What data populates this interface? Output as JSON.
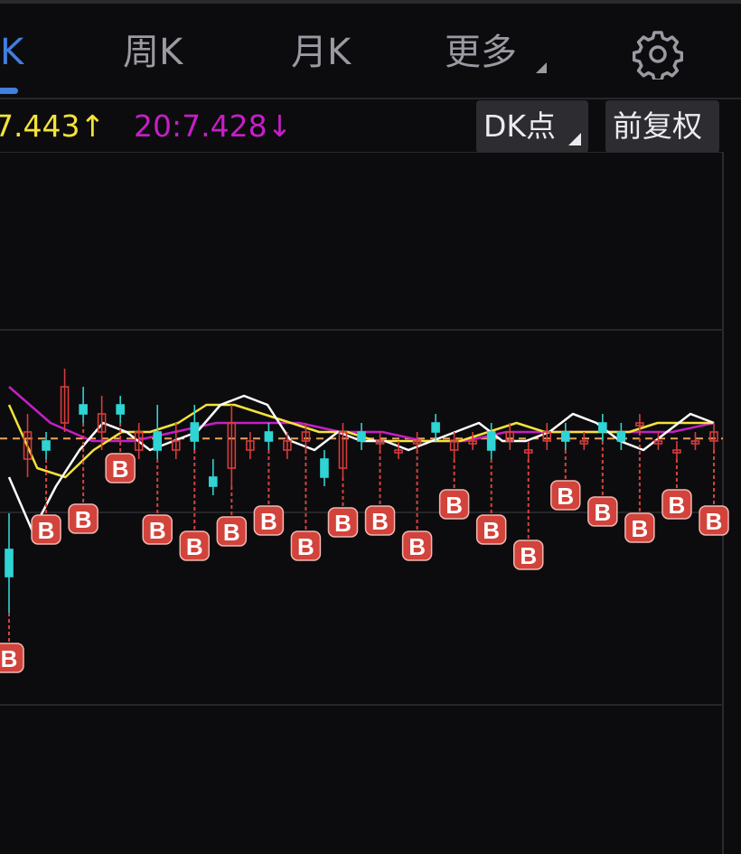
{
  "tabs": [
    {
      "label": "K",
      "active": true
    },
    {
      "label": "周K",
      "active": false
    },
    {
      "label": "月K",
      "active": false
    },
    {
      "label": "更多",
      "active": false
    }
  ],
  "icons": {
    "settings": "gear-icon",
    "more_caret": "triangle-icon"
  },
  "ma": {
    "ma10_label": "7.443↑",
    "ma20_label": "20:7.428↓"
  },
  "buttons": {
    "dk_label": "DK点",
    "fq_label": "前复权"
  },
  "colors": {
    "background": "#0c0c0e",
    "accent": "#3f7fe0",
    "ma5": "#ffffff",
    "ma10": "#f5e23a",
    "ma20": "#c61ec6",
    "candle_up": "#d83b3b",
    "candle_down": "#2fd4d4",
    "buy_marker": "#d2433b",
    "reference_line": "#e8a35c"
  },
  "chart_data": {
    "type": "candlestick",
    "buy_marker_label": "B",
    "reference_price": 7.428,
    "candles": [
      {
        "open": 6.2,
        "high": 6.6,
        "low": 5.5,
        "close": 5.9
      },
      {
        "open": 7.2,
        "high": 7.7,
        "low": 7.0,
        "close": 7.5
      },
      {
        "open": 7.4,
        "high": 7.5,
        "low": 7.2,
        "close": 7.3
      },
      {
        "open": 7.6,
        "high": 8.2,
        "low": 7.5,
        "close": 8.0
      },
      {
        "open": 7.8,
        "high": 8.0,
        "low": 7.6,
        "close": 7.7
      },
      {
        "open": 7.5,
        "high": 7.9,
        "low": 7.3,
        "close": 7.7
      },
      {
        "open": 7.8,
        "high": 7.9,
        "low": 7.6,
        "close": 7.7
      },
      {
        "open": 7.3,
        "high": 7.6,
        "low": 7.2,
        "close": 7.5
      },
      {
        "open": 7.5,
        "high": 7.8,
        "low": 7.2,
        "close": 7.3
      },
      {
        "open": 7.3,
        "high": 7.6,
        "low": 7.2,
        "close": 7.4
      },
      {
        "open": 7.6,
        "high": 7.8,
        "low": 7.3,
        "close": 7.4
      },
      {
        "open": 7.0,
        "high": 7.2,
        "low": 6.8,
        "close": 6.9
      },
      {
        "open": 7.1,
        "high": 7.8,
        "low": 6.9,
        "close": 7.6
      },
      {
        "open": 7.3,
        "high": 7.5,
        "low": 7.2,
        "close": 7.4
      },
      {
        "open": 7.5,
        "high": 7.6,
        "low": 7.3,
        "close": 7.4
      },
      {
        "open": 7.3,
        "high": 7.5,
        "low": 7.2,
        "close": 7.4
      },
      {
        "open": 7.4,
        "high": 7.6,
        "low": 7.3,
        "close": 7.5
      },
      {
        "open": 7.2,
        "high": 7.3,
        "low": 6.9,
        "close": 7.0
      },
      {
        "open": 7.1,
        "high": 7.6,
        "low": 7.0,
        "close": 7.5
      },
      {
        "open": 7.5,
        "high": 7.6,
        "low": 7.3,
        "close": 7.4
      },
      {
        "open": 7.4,
        "high": 7.5,
        "low": 7.3,
        "close": 7.4
      },
      {
        "open": 7.3,
        "high": 7.4,
        "low": 7.2,
        "close": 7.3
      },
      {
        "open": 7.4,
        "high": 7.5,
        "low": 7.3,
        "close": 7.4
      },
      {
        "open": 7.6,
        "high": 7.7,
        "low": 7.4,
        "close": 7.5
      },
      {
        "open": 7.3,
        "high": 7.5,
        "low": 7.2,
        "close": 7.4
      },
      {
        "open": 7.4,
        "high": 7.5,
        "low": 7.3,
        "close": 7.4
      },
      {
        "open": 7.5,
        "high": 7.6,
        "low": 7.2,
        "close": 7.3
      },
      {
        "open": 7.4,
        "high": 7.6,
        "low": 7.3,
        "close": 7.5
      },
      {
        "open": 7.3,
        "high": 7.4,
        "low": 7.2,
        "close": 7.3
      },
      {
        "open": 7.4,
        "high": 7.6,
        "low": 7.3,
        "close": 7.5
      },
      {
        "open": 7.5,
        "high": 7.6,
        "low": 7.3,
        "close": 7.4
      },
      {
        "open": 7.4,
        "high": 7.5,
        "low": 7.3,
        "close": 7.4
      },
      {
        "open": 7.6,
        "high": 7.7,
        "low": 7.4,
        "close": 7.5
      },
      {
        "open": 7.5,
        "high": 7.6,
        "low": 7.3,
        "close": 7.4
      },
      {
        "open": 7.6,
        "high": 7.7,
        "low": 7.5,
        "close": 7.6
      },
      {
        "open": 7.4,
        "high": 7.5,
        "low": 7.3,
        "close": 7.4
      },
      {
        "open": 7.3,
        "high": 7.4,
        "low": 7.2,
        "close": 7.3
      },
      {
        "open": 7.4,
        "high": 7.5,
        "low": 7.3,
        "close": 7.4
      },
      {
        "open": 7.4,
        "high": 7.6,
        "low": 7.3,
        "close": 7.5
      }
    ],
    "ma5": [
      7.0,
      6.4,
      6.9,
      7.3,
      7.6,
      7.5,
      7.3,
      7.4,
      7.5,
      7.8,
      7.9,
      7.8,
      7.4,
      7.3,
      7.5,
      7.4,
      7.4,
      7.3,
      7.4,
      7.5,
      7.6,
      7.4,
      7.4,
      7.5,
      7.7,
      7.6,
      7.4,
      7.3,
      7.5,
      7.7,
      7.6
    ],
    "ma10": [
      7.8,
      7.1,
      7.0,
      7.3,
      7.5,
      7.5,
      7.6,
      7.8,
      7.8,
      7.7,
      7.6,
      7.5,
      7.5,
      7.4,
      7.4,
      7.4,
      7.4,
      7.5,
      7.6,
      7.5,
      7.5,
      7.5,
      7.5,
      7.6,
      7.6,
      7.6
    ],
    "ma20": [
      8.0,
      7.6,
      7.4,
      7.4,
      7.5,
      7.6,
      7.6,
      7.6,
      7.5,
      7.5,
      7.4,
      7.4,
      7.5,
      7.5,
      7.5,
      7.5,
      7.5,
      7.6
    ]
  }
}
